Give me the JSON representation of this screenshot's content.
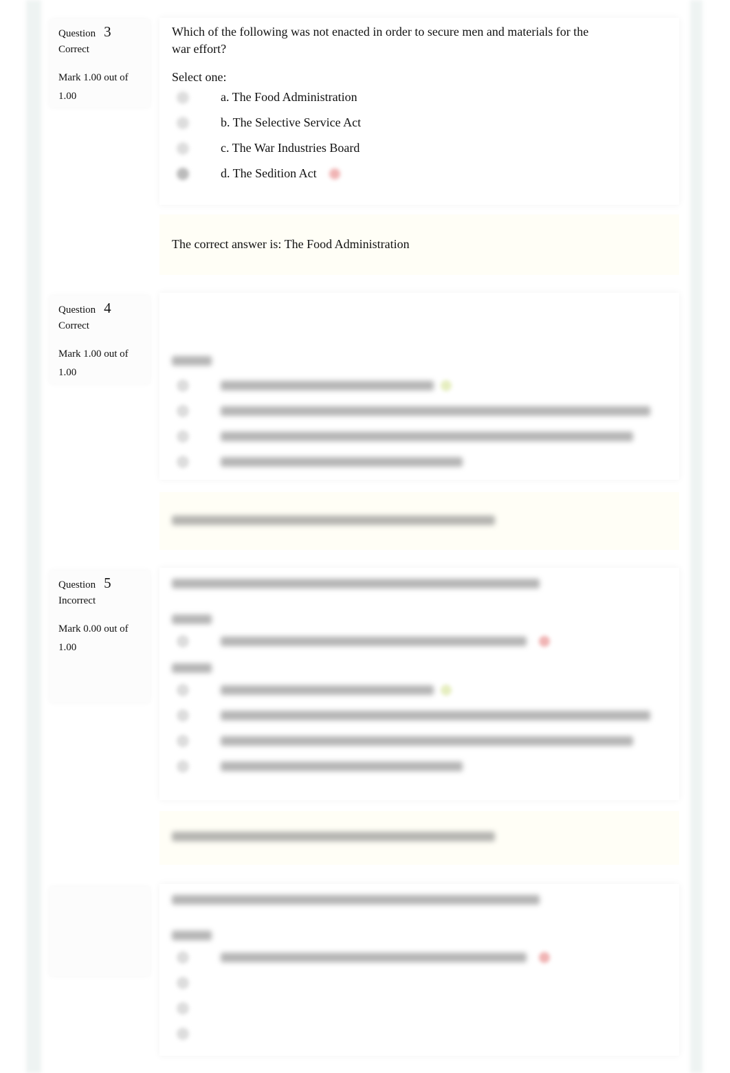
{
  "questions": [
    {
      "label": "Question",
      "number": "3",
      "status": "Correct",
      "mark": "Mark 1.00 out of",
      "mark_total": "1.00",
      "text": "Which of the following was not enacted in order to secure men and materials for the war effort?",
      "select_label": "Select one:",
      "options": [
        "a. The Food Administration",
        "b. The Selective Service Act",
        "c. The War Industries Board",
        "d. The Sedition Act"
      ],
      "selected_option": "d",
      "selected_mark": "incorrect-icon",
      "feedback": "The correct answer is: The Food Administration"
    },
    {
      "label": "Question",
      "number": "4",
      "status": "Correct",
      "mark": "Mark 1.00 out of",
      "mark_total": "1.00"
    },
    {
      "label": "Question",
      "number": "5",
      "status": "Incorrect",
      "mark": "Mark 0.00 out of",
      "mark_total": "1.00"
    }
  ]
}
